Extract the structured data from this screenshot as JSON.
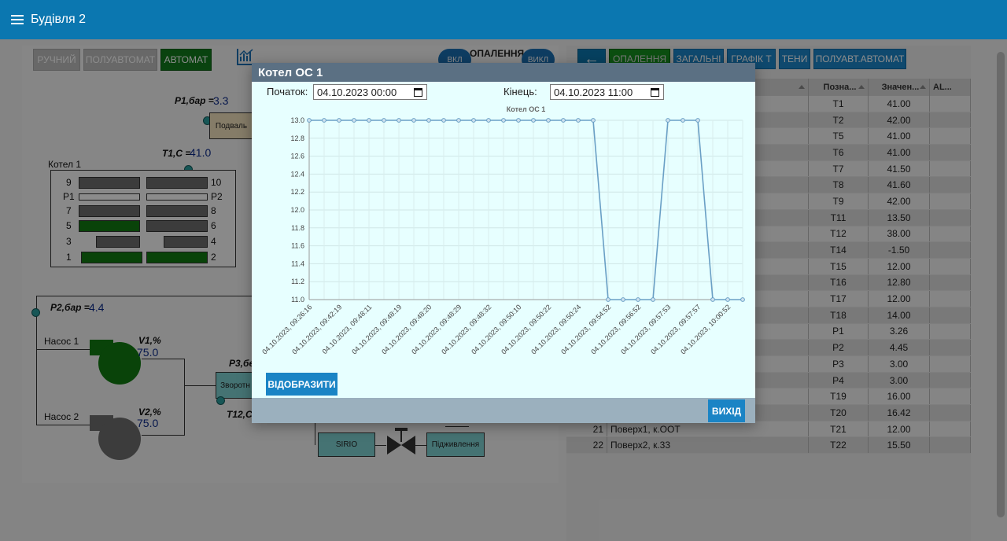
{
  "app": {
    "title": "Будівля 2"
  },
  "modes": {
    "manual": "РУЧНИЙ",
    "semi": "ПОЛУАВТОМАТ",
    "auto": "АВТОМАТ"
  },
  "heating": {
    "on": "ВКЛ",
    "label": "ОПАЛЕННЯ",
    "off": "ВИКЛ"
  },
  "nav": {
    "back_icon": "arrow-left-icon",
    "tabs": [
      "ОПАЛЕННЯ",
      "ЗАГАЛЬНІ",
      "ГРАФІК Т",
      "ТЕНИ",
      "ПОЛУАВТ.АВТОМАТ"
    ]
  },
  "table": {
    "headers": [
      "Позна...",
      "Значен...",
      "AL..."
    ],
    "rows": [
      {
        "n": "",
        "name": "",
        "code": "T1",
        "value": "41.00"
      },
      {
        "n": "",
        "name": "",
        "code": "T2",
        "value": "42.00"
      },
      {
        "n": "",
        "name": "",
        "code": "T5",
        "value": "41.00"
      },
      {
        "n": "",
        "name": "",
        "code": "T6",
        "value": "41.00"
      },
      {
        "n": "",
        "name": "",
        "code": "T7",
        "value": "41.50"
      },
      {
        "n": "",
        "name": "",
        "code": "T8",
        "value": "41.60"
      },
      {
        "n": "",
        "name": "",
        "code": "T9",
        "value": "42.00"
      },
      {
        "n": "",
        "name": "",
        "code": "T11",
        "value": "13.50"
      },
      {
        "n": "",
        "name": "",
        "code": "T12",
        "value": "38.00"
      },
      {
        "n": "",
        "name": "",
        "code": "T14",
        "value": "-1.50"
      },
      {
        "n": "",
        "name": "",
        "code": "T15",
        "value": "12.00"
      },
      {
        "n": "",
        "name": "",
        "code": "T16",
        "value": "12.80"
      },
      {
        "n": "",
        "name": "",
        "code": "T17",
        "value": "12.00"
      },
      {
        "n": "",
        "name": "",
        "code": "T18",
        "value": "14.00"
      },
      {
        "n": "",
        "name": "",
        "code": "P1",
        "value": "3.26"
      },
      {
        "n": "",
        "name": "",
        "code": "P2",
        "value": "4.45"
      },
      {
        "n": "",
        "name": "",
        "code": "P3",
        "value": "3.00"
      },
      {
        "n": "",
        "name": "",
        "code": "P4",
        "value": "3.00"
      },
      {
        "n": "",
        "name": "",
        "code": "T19",
        "value": "16.00"
      },
      {
        "n": "",
        "name": "",
        "code": "T20",
        "value": "16.42"
      },
      {
        "n": "21",
        "name": "Поверх1, к.ООТ",
        "code": "T21",
        "value": "12.00"
      },
      {
        "n": "22",
        "name": "Поверх2, к.33",
        "code": "T22",
        "value": "15.50"
      }
    ]
  },
  "scheme": {
    "p1_label": "P1,бар =",
    "p1_value": "3.3",
    "basement_label": "Подваль",
    "t1_label": "T1,C =",
    "t1_value": "41.0",
    "boiler_label": "Котел 1",
    "boiler_left": [
      "9",
      "P1",
      "7",
      "5",
      "3",
      "1"
    ],
    "boiler_right": [
      "10",
      "P2",
      "8",
      "6",
      "4",
      "2"
    ],
    "p2_label": "P2,бар =",
    "p2_value": "4.4",
    "pump1_label": "Насос 1",
    "v1_label": "V1,%",
    "v1_value": "75.0",
    "pump2_label": "Насос 2",
    "v2_label": "V2,%",
    "v2_value": "75.0",
    "p3_label": "P3,бе",
    "return_label": "Зворотн",
    "t12_label": "T12,C",
    "sirio_label": "SIRIO",
    "feed_label": "Підживлення"
  },
  "modal": {
    "title": "Котел ОС 1",
    "start_label": "Початок:",
    "start_value": "04.10.2023 00:00",
    "end_label": "Кінець:",
    "end_value": "04.10.2023 11:00",
    "show_button": "ВІДОБРАЗИТИ",
    "exit_button": "ВИХІД"
  },
  "chart_data": {
    "type": "line",
    "title": "Котел ОС 1",
    "ylim": [
      11.0,
      13.0
    ],
    "yticks": [
      "13.0",
      "12.8",
      "12.6",
      "12.4",
      "12.2",
      "12.0",
      "11.8",
      "11.6",
      "11.4",
      "11.2",
      "11.0"
    ],
    "xtick_labels": [
      "04.10.2023, 09:26:16",
      "04.10.2023, 09:42:19",
      "04.10.2023, 09:48:11",
      "04.10.2023, 09:48:19",
      "04.10.2023, 09:48:20",
      "04.10.2023, 09:48:29",
      "04.10.2023, 09:48:32",
      "04.10.2023, 09:50:10",
      "04.10.2023, 09:50:22",
      "04.10.2023, 09:50:24",
      "04.10.2023, 09:54:52",
      "04.10.2023, 09:56:52",
      "04.10.2023, 09:57:53",
      "04.10.2023, 09:57:57",
      "04.10.2023, 10:00:52"
    ],
    "series": [
      {
        "values": [
          13,
          13,
          13,
          13,
          13,
          13,
          13,
          13,
          13,
          13,
          13,
          13,
          13,
          13,
          13,
          13,
          13,
          13,
          13,
          13,
          11,
          11,
          11,
          11,
          13,
          13,
          13,
          11,
          11,
          11
        ]
      }
    ],
    "color": "#6a9fc5",
    "grid": true
  }
}
